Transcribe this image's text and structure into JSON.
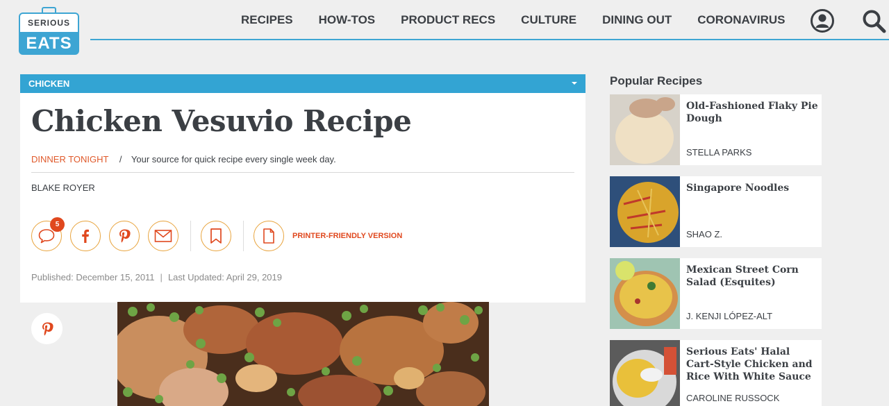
{
  "logo": {
    "line1": "SERIOUS",
    "line2": "EATS"
  },
  "nav": [
    "RECIPES",
    "HOW-TOS",
    "PRODUCT RECS",
    "CULTURE",
    "DINING OUT",
    "CORONAVIRUS"
  ],
  "category": "CHICKEN",
  "article": {
    "title": "Chicken Vesuvio Recipe",
    "series": "DINNER TONIGHT",
    "separator": "/",
    "series_desc": "Your source for quick recipe every single week day.",
    "author": "BLAKE ROYER",
    "comment_count": "5",
    "printer_label": "PRINTER-FRIENDLY VERSION",
    "published": "Published: December 15, 2011",
    "date_separator": "|",
    "updated": "Last Updated: April 29, 2019"
  },
  "sidebar": {
    "title": "Popular Recipes",
    "items": [
      {
        "name": "Old-Fashioned Flaky Pie Dough",
        "author": "STELLA PARKS"
      },
      {
        "name": "Singapore Noodles",
        "author": "SHAO Z."
      },
      {
        "name": "Mexican Street Corn Salad (Esquites)",
        "author": "J. KENJI LÓPEZ-ALT"
      },
      {
        "name": "Serious Eats' Halal Cart-Style Chicken and Rice With White Sauce",
        "author": "CAROLINE RUSSOCK"
      }
    ]
  },
  "colors": {
    "accent_blue": "#33a4d3",
    "accent_orange": "#e0481e",
    "icon_gold": "#e8a33c"
  }
}
